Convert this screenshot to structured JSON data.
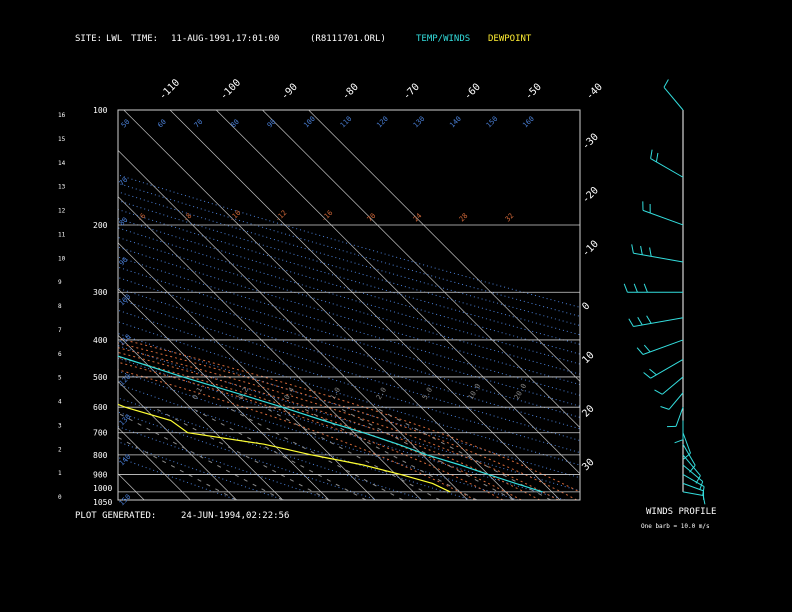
{
  "header": {
    "site_label": "SITE:",
    "site_value": "LWL",
    "time_label": "TIME:",
    "time_value": "11-AUG-1991,17:01:00",
    "file_id": "(R8111701.ORL)",
    "temp_legend": "TEMP/WINDS",
    "dew_legend": "DEWPOINT"
  },
  "footer": {
    "generated_label": "PLOT GENERATED:",
    "generated_value": "24-JUN-1994,02:22:56"
  },
  "winds_panel": {
    "title": "WINDS PROFILE",
    "note": "One barb = 10.0 m/s"
  },
  "colors": {
    "background": "#000000",
    "temperature": "#33dddd",
    "dewpoint": "#ffff33",
    "winds": "#33dddd",
    "frame": "#cfcfcf",
    "isotherms": "#bfbfbf",
    "dry_adiabats": "#4a7fd6",
    "moist_adiabats": "#d66a3a",
    "mixing_ratio": "#8a8a8a",
    "legend_temp": "#33dddd",
    "legend_dew": "#ffee33",
    "header_text": "#ffffff"
  },
  "chart_data": {
    "type": "line",
    "title": "",
    "left_axis_km": [
      "16",
      "15",
      "14",
      "13",
      "12",
      "11",
      "10",
      "9",
      "8",
      "7",
      "6",
      "5",
      "4",
      "3",
      "2",
      "1",
      "0"
    ],
    "pressure_levels_hpa": [
      100,
      200,
      300,
      400,
      500,
      600,
      700,
      800,
      900,
      1000,
      1050
    ],
    "pressure_tick_labels": [
      "100",
      "200",
      "300",
      "400",
      "500",
      "600",
      "700",
      "800",
      "900",
      "1000",
      "1050"
    ],
    "isotherm_top_labels": [
      "-110",
      "-100",
      "-90",
      "-80",
      "-70",
      "-60",
      "-50",
      "-40"
    ],
    "isotherm_right_labels": [
      "-30",
      "-20",
      "-10",
      "0",
      "10",
      "20",
      "30"
    ],
    "dry_adiabat_labels": [
      "50",
      "60",
      "70",
      "80",
      "90",
      "100",
      "110",
      "120",
      "130",
      "140",
      "150",
      "160"
    ],
    "moist_adiabat_labels": [
      "-6",
      "-8",
      "-10",
      "-12",
      "-16",
      "70",
      "24",
      "28",
      "32"
    ],
    "mixing_ratio_labels": [
      "0.1",
      "0.2",
      "0.4",
      "1.0",
      "2.0",
      "5.0",
      "10.0",
      "20.0"
    ],
    "series": [
      {
        "name": "TEMP/WINDS",
        "variable": "temperature_c",
        "points": [
          [
            100,
            -72
          ],
          [
            150,
            -78
          ],
          [
            170,
            -82
          ],
          [
            200,
            -80
          ],
          [
            250,
            -70
          ],
          [
            300,
            -58
          ],
          [
            350,
            -49
          ],
          [
            400,
            -42
          ],
          [
            450,
            -33
          ],
          [
            500,
            -25
          ],
          [
            550,
            -17
          ],
          [
            600,
            -10
          ],
          [
            650,
            -4
          ],
          [
            700,
            2
          ],
          [
            750,
            7
          ],
          [
            800,
            11
          ],
          [
            850,
            16
          ],
          [
            900,
            20
          ],
          [
            950,
            24
          ],
          [
            1000,
            28
          ]
        ]
      },
      {
        "name": "DEWPOINT",
        "variable": "dewpoint_c",
        "points": [
          [
            100,
            -88
          ],
          [
            150,
            -96
          ],
          [
            170,
            -100
          ],
          [
            200,
            -101
          ],
          [
            240,
            -100
          ],
          [
            270,
            -96
          ],
          [
            290,
            -88
          ],
          [
            300,
            -100
          ],
          [
            320,
            -101
          ],
          [
            350,
            -86
          ],
          [
            380,
            -80
          ],
          [
            420,
            -68
          ],
          [
            460,
            -66
          ],
          [
            480,
            -78
          ],
          [
            500,
            -75
          ],
          [
            520,
            -63
          ],
          [
            540,
            -56
          ],
          [
            560,
            -48
          ],
          [
            600,
            -44
          ],
          [
            650,
            -37
          ],
          [
            700,
            -36
          ],
          [
            750,
            -22
          ],
          [
            800,
            -14
          ],
          [
            850,
            -5
          ],
          [
            900,
            1
          ],
          [
            950,
            6
          ],
          [
            1000,
            8
          ]
        ]
      }
    ],
    "winds_profile_deg_speed": [
      [
        100,
        320,
        12
      ],
      [
        150,
        300,
        18
      ],
      [
        200,
        290,
        22
      ],
      [
        250,
        280,
        28
      ],
      [
        300,
        270,
        32
      ],
      [
        350,
        260,
        28
      ],
      [
        400,
        250,
        22
      ],
      [
        450,
        240,
        18
      ],
      [
        500,
        230,
        10
      ],
      [
        550,
        220,
        6
      ],
      [
        600,
        200,
        5
      ],
      [
        650,
        180,
        4
      ],
      [
        700,
        160,
        6
      ],
      [
        750,
        150,
        8
      ],
      [
        800,
        140,
        10
      ],
      [
        850,
        130,
        9
      ],
      [
        900,
        120,
        8
      ],
      [
        950,
        110,
        6
      ],
      [
        1000,
        100,
        5
      ]
    ],
    "ylim_hpa": [
      100,
      1050
    ],
    "y_scale": "log",
    "grid": true
  }
}
